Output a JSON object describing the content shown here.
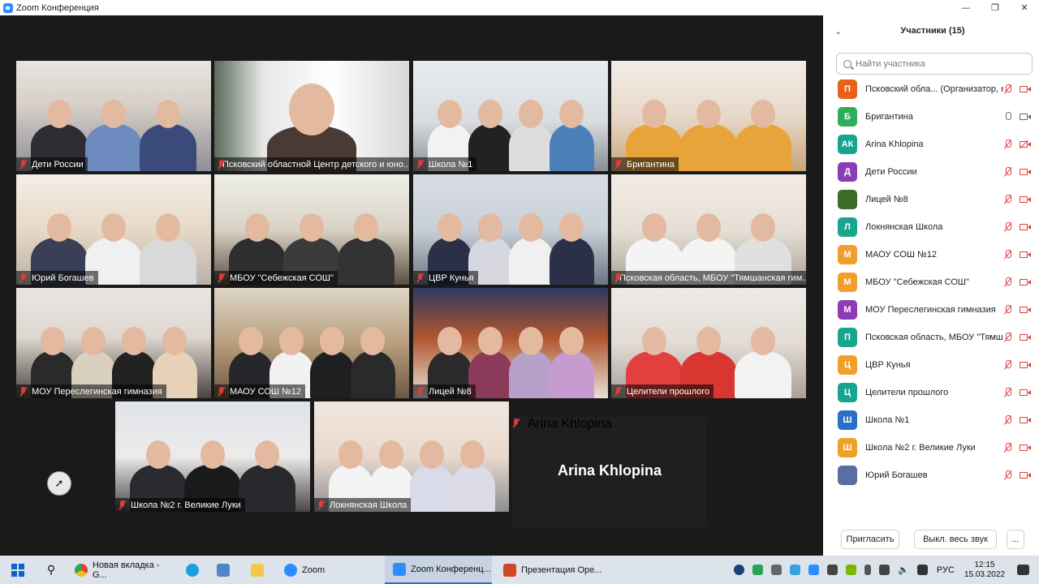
{
  "window": {
    "title": "Zoom Конференция",
    "minimize": "—",
    "maximize": "❐",
    "close": "✕"
  },
  "tiles": [
    {
      "name": "Дети России"
    },
    {
      "name": "Псковский областной Центр детского и юно..."
    },
    {
      "name": "Школа №1"
    },
    {
      "name": "Бригантина"
    },
    {
      "name": "Юрий Богашев"
    },
    {
      "name": "МБОУ \"Себежская СОШ\""
    },
    {
      "name": "ЦВР Кунья"
    },
    {
      "name": "Псковская область, МБОУ \"Тямшанская гим..."
    },
    {
      "name": "МОУ Переслегинская гимназия"
    },
    {
      "name": "МАОУ СОШ №12"
    },
    {
      "name": "Лицей №8"
    },
    {
      "name": "Целители прошлого"
    },
    {
      "name": "Школа №2 г. Великие Луки"
    },
    {
      "name": "Локнянская Школа"
    }
  ],
  "namecard": {
    "big_name": "Arina Khlopina",
    "label": "Arina Khlopina"
  },
  "panel": {
    "title": "Участники (15)",
    "search_placeholder": "Найти участника",
    "participants": [
      {
        "initials": "П",
        "name": "Псковский обла... (Организатор, я)",
        "color": "#e8601c"
      },
      {
        "initials": "Б",
        "name": "Бригантина",
        "color": "#2eac5a"
      },
      {
        "initials": "АК",
        "name": "Arina Khlopina",
        "color": "#17a58f"
      },
      {
        "initials": "Д",
        "name": "Дети России",
        "color": "#8e3bb8"
      },
      {
        "initials": "",
        "name": "Лицей №8",
        "color": "#3d6b2b"
      },
      {
        "initials": "Л",
        "name": "Локнянская Школа",
        "color": "#17a58f"
      },
      {
        "initials": "М",
        "name": "МАОУ СОШ №12",
        "color": "#f0a02a"
      },
      {
        "initials": "М",
        "name": "МБОУ \"Себежская СОШ\"",
        "color": "#f0a02a"
      },
      {
        "initials": "М",
        "name": "МОУ Переслегинская гимназия",
        "color": "#8e3bb8"
      },
      {
        "initials": "П",
        "name": "Псковская область, МБОУ \"Тямш...",
        "color": "#17a58f"
      },
      {
        "initials": "Ц",
        "name": "ЦВР Кунья",
        "color": "#f0a02a"
      },
      {
        "initials": "Ц",
        "name": "Целители прошлого",
        "color": "#17a58f"
      },
      {
        "initials": "Ш",
        "name": "Школа №1",
        "color": "#2a6fc6"
      },
      {
        "initials": "Ш",
        "name": "Школа №2 г. Великие Луки",
        "color": "#f0a02a"
      },
      {
        "initials": "",
        "name": "Юрий Богашев",
        "color": "#5a6fa0"
      }
    ],
    "invite_label": "Пригласить",
    "mute_all_label": "Выкл. весь звук",
    "more_label": "..."
  },
  "taskbar": {
    "chrome_label": "Новая вкладка - G...",
    "zoom_label": "Zoom",
    "zoom_conf_label": "Zoom Конференц...",
    "ppt_label": "Презентация Оре...",
    "lang": "РУС",
    "time": "12:15",
    "date": "15.03.2022"
  }
}
